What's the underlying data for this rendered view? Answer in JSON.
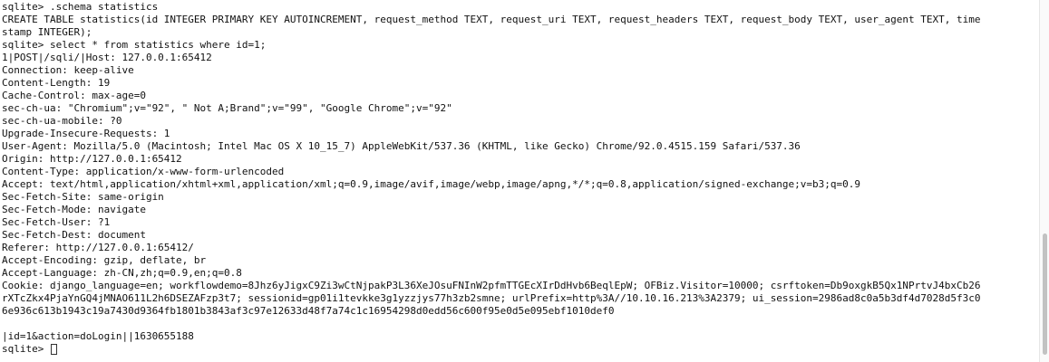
{
  "terminal": {
    "lines": [
      "sqlite> .schema statistics",
      "CREATE TABLE statistics(id INTEGER PRIMARY KEY AUTOINCREMENT, request_method TEXT, request_uri TEXT, request_headers TEXT, request_body TEXT, user_agent TEXT, time",
      "stamp INTEGER);",
      "sqlite> select * from statistics where id=1;",
      "1|POST|/sqli/|Host: 127.0.0.1:65412",
      "Connection: keep-alive",
      "Content-Length: 19",
      "Cache-Control: max-age=0",
      "sec-ch-ua: \"Chromium\";v=\"92\", \" Not A;Brand\";v=\"99\", \"Google Chrome\";v=\"92\"",
      "sec-ch-ua-mobile: ?0",
      "Upgrade-Insecure-Requests: 1",
      "User-Agent: Mozilla/5.0 (Macintosh; Intel Mac OS X 10_15_7) AppleWebKit/537.36 (KHTML, like Gecko) Chrome/92.0.4515.159 Safari/537.36",
      "Origin: http://127.0.0.1:65412",
      "Content-Type: application/x-www-form-urlencoded",
      "Accept: text/html,application/xhtml+xml,application/xml;q=0.9,image/avif,image/webp,image/apng,*/*;q=0.8,application/signed-exchange;v=b3;q=0.9",
      "Sec-Fetch-Site: same-origin",
      "Sec-Fetch-Mode: navigate",
      "Sec-Fetch-User: ?1",
      "Sec-Fetch-Dest: document",
      "Referer: http://127.0.0.1:65412/",
      "Accept-Encoding: gzip, deflate, br",
      "Accept-Language: zh-CN,zh;q=0.9,en;q=0.8",
      "Cookie: django_language=en; workflowdemo=8Jhz6yJigxC9Zi3wCtNjpakP3L36XeJOsuFNInW2pfmTTGEcXIrDdHvb6BeqlEpW; OFBiz.Visitor=10000; csrftoken=Db9oxgkB5Qx1NPrtvJ4bxCb26",
      "rXTcZkx4PjaYnGQ4jMNAO611L2h6DSEZAFzp3t7; sessionid=gp01i1tevkke3g1yzzjys77h3zb2smne; urlPrefix=http%3A//10.10.16.213%3A2379; ui_session=2986ad8c0a5b3df4d7028d5f3c0",
      "6e936c613b1943c19a7430d9364fb1801b3843af3c97e12633d48f7a74c1c16954298d0edd56c600f95e0d5e095ebf1010def0",
      "",
      "|id=1&action=doLogin||1630655188"
    ],
    "prompt": "sqlite> "
  }
}
